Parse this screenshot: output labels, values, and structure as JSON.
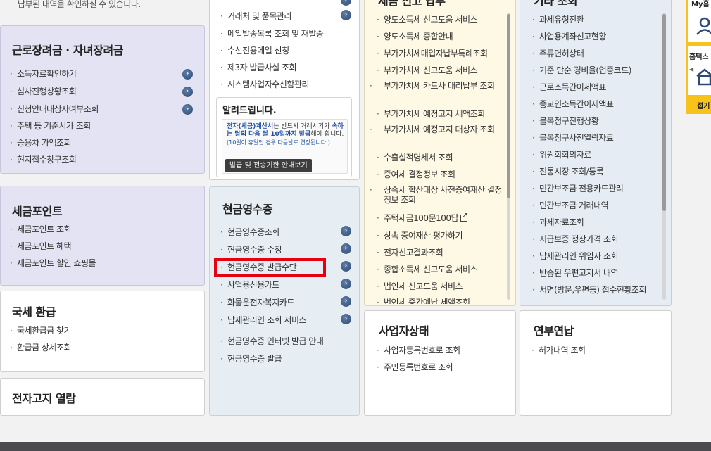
{
  "top_text": "납부된 내역을 확인하실 수 있습니다.",
  "labor": {
    "title": "근로장려금 · 자녀장려금",
    "items": [
      "소득자료확인하기",
      "심사진행상황조회",
      "신청안내대상자여부조회",
      "주택 등 기준시가 조회",
      "승용차 가액조회",
      "현지접수창구조회"
    ]
  },
  "taxpoint": {
    "title": "세금포인트",
    "items": [
      "세금포인트 조회",
      "세금포인트 혜택",
      "세금포인트 할인 쇼핑몰"
    ]
  },
  "refund": {
    "title": "국세 환급",
    "items": [
      "국세환급금 찾기",
      "환급금 상세조회"
    ]
  },
  "ebill": {
    "title": "전자고지 열람"
  },
  "einvoice": {
    "items": [
      "거래처 및 품목관리",
      "메일발송목록 조회 및 재발송",
      "수신전용메일 신청",
      "제3자 발급사실 조회",
      "시스템사업자수신함관리"
    ]
  },
  "notice": {
    "title": "알려드립니다.",
    "text_a": "전자(세금)계산서",
    "text_b": "는 반드시 거래시기가",
    "text_c": "속하는 달의 다음 달 10일까지 발급",
    "text_d": "해야 합니다.",
    "text_sub": "(10일이 휴일인 경우 다음날로 연장됩니다.)",
    "button": "발급 및 전송기한 안내보기"
  },
  "cash": {
    "title": "현금영수증",
    "items": [
      "현금영수증조회",
      "현금영수증 수정",
      "현금영수증 발급수단",
      "사업용신용카드",
      "화물운전자복지카드",
      "납세관리인 조회 서비스",
      "현금영수증 인터넷 발급 안내",
      "현금영수증 발급"
    ]
  },
  "filing": {
    "title": "세금 신고 납부",
    "items": [
      "양도소득세 신고도움 서비스",
      "양도소득세 종합안내",
      "부가가치세매입자납부특례조회",
      "부가가치세 신고도움 서비스",
      "부가가치세 카드사 대리납부 조회",
      "부가가치세 예정고지 세액조회",
      "부가가치세 예정고지 대상자 조회",
      "수출실적명세서 조회",
      "증여세 결정정보 조회",
      "상속세 합산대상 사전증여재산 결정정보 조회",
      "주택세금100문100답",
      "상속 증여재산 평가하기",
      "전자신고결과조회",
      "종합소득세 신고도움 서비스",
      "법인세 신고도움 서비스",
      "법인세 중간예납 세액조회"
    ]
  },
  "etc": {
    "title": "기타 조회",
    "items": [
      "과세유형전환",
      "사업용계좌신고현황",
      "주류면허상태",
      "기준 단순 경비율(업종코드)",
      "근로소득간이세액표",
      "종교인소득간이세액표",
      "불복청구진행상황",
      "불복청구사전열람자료",
      "위원회회의자료",
      "전통시장 조회/등록",
      "민간보조금 전용카드관리",
      "민간보조금 거래내역",
      "과세자료조회",
      "지급보증 정상가격 조회",
      "납세관리인 위임자 조회",
      "반송된 우편고지서 내역",
      "서면(방문,우편등) 접수현황조회"
    ]
  },
  "bizstatus": {
    "title": "사업자상태",
    "items": [
      "사업자등록번호로 조회",
      "주민등록번호로 조회"
    ]
  },
  "installment": {
    "title": "연부연납",
    "items": [
      "허가내역 조회"
    ]
  },
  "sidebar": {
    "my": "My홈",
    "hometax": "홈택스",
    "collapse": "접기"
  }
}
